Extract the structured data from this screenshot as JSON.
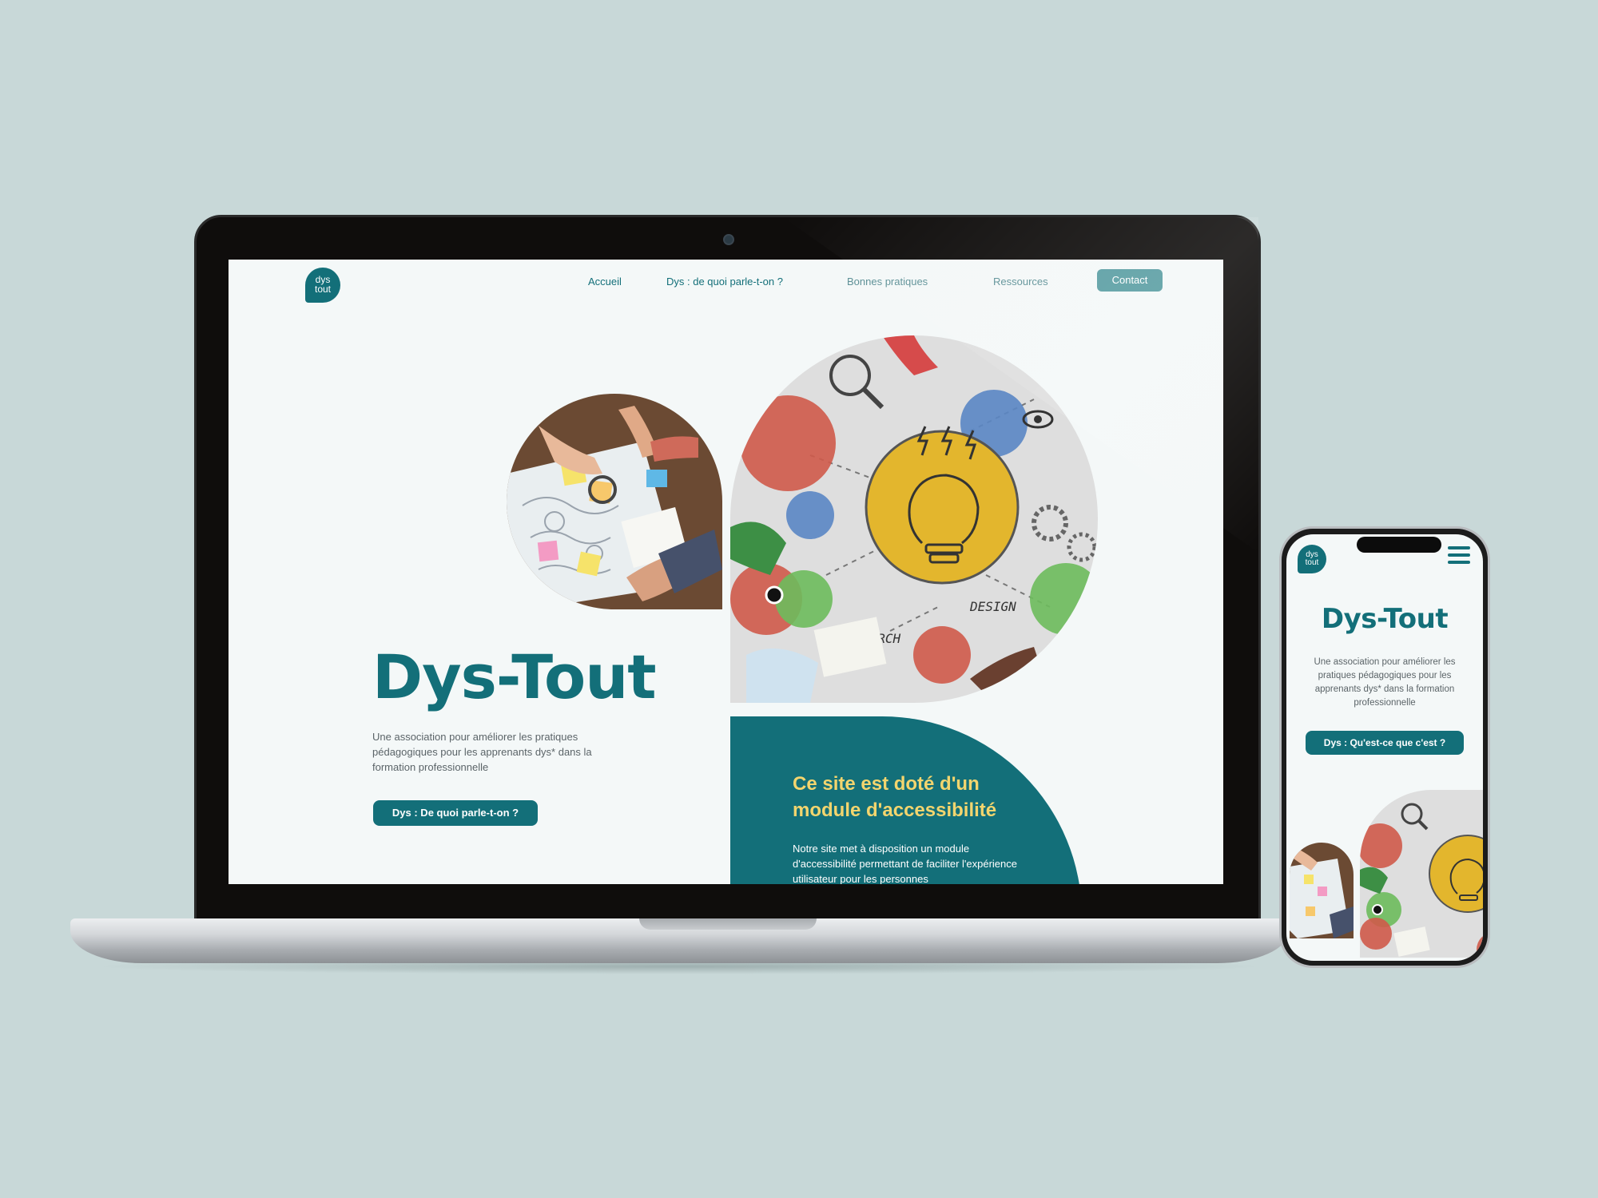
{
  "site": {
    "logo": {
      "line1": "dys",
      "line2": "tout"
    },
    "nav": {
      "items": [
        "Accueil",
        "Dys : de quoi parle-t-on ?",
        "Bonnes pratiques",
        "Ressources"
      ],
      "contact": "Contact"
    },
    "hero": {
      "title": "Dys-Tout",
      "description": "Une association pour améliorer les pratiques pédagogiques pour les apprenants dys* dans la formation professionnelle",
      "cta": "Dys : De quoi parle-t-on ?"
    },
    "accessibility": {
      "title": "Ce site est doté d'un module d'accessibilité",
      "text": "Notre site met à disposition un module d'accessibilité permettant de faciliter l'expérience utilisateur pour les personnes"
    },
    "illustration_words": {
      "design": "DESIGN",
      "search": "EARCH"
    }
  },
  "mobile": {
    "logo": {
      "line1": "dys",
      "line2": "tout"
    },
    "title": "Dys-Tout",
    "description": "Une association pour améliorer les pratiques pédagogiques pour les apprenants dys* dans la formation professionnelle",
    "cta": "Dys : Qu'est-ce que c'est ?"
  },
  "colors": {
    "background": "#c8d8d8",
    "brand_teal": "#136f79",
    "accent_yellow": "#f3d56e",
    "contact_button": "#5a9ea3"
  }
}
